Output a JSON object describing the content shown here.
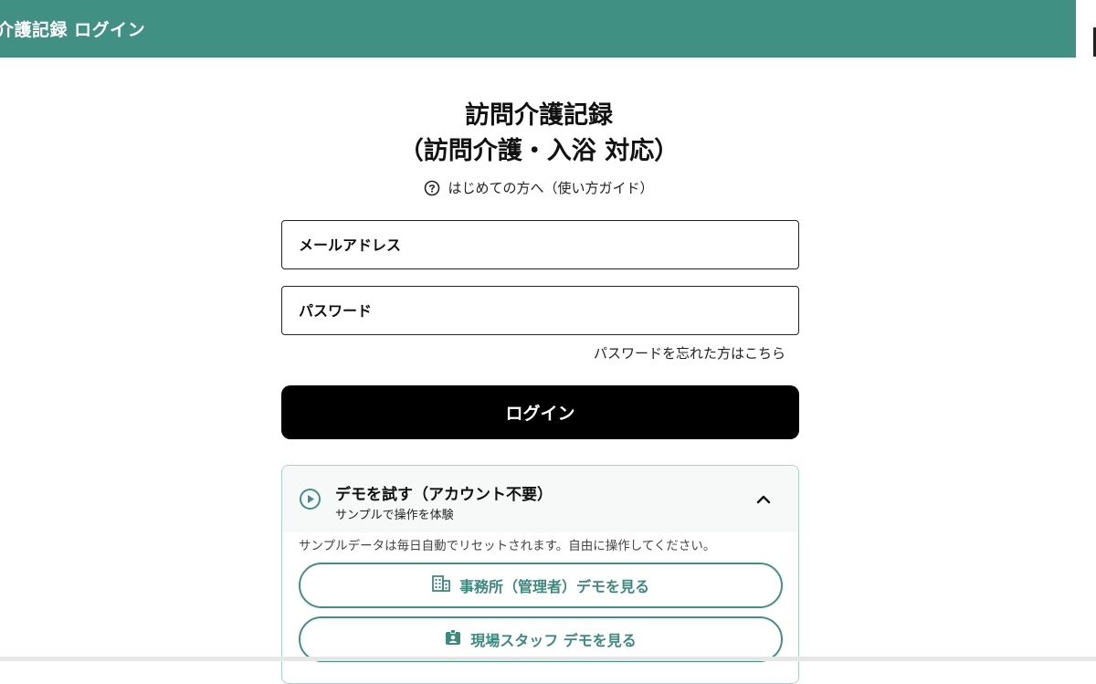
{
  "header": {
    "title": "介護記録 ログイン"
  },
  "title": {
    "line1": "訪問介護記録",
    "line2": "（訪問介護・入浴 対応）"
  },
  "guide": {
    "label": "はじめての方へ（使い方ガイド）"
  },
  "form": {
    "email_placeholder": "メールアドレス",
    "password_placeholder": "パスワード",
    "forgot_label": "パスワードを忘れた方はこちら",
    "login_label": "ログイン"
  },
  "demo": {
    "title": "デモを試す（アカウント不要）",
    "subtitle": "サンプルで操作を体験",
    "note": "サンプルデータは毎日自動でリセットされます。自由に操作してください。",
    "admin_button": "事務所（管理者）デモを見る",
    "staff_button": "現場スタッフ デモを見る",
    "expanded": true
  },
  "colors": {
    "header": "#419084",
    "accent": "#419084",
    "button": "#000000"
  }
}
